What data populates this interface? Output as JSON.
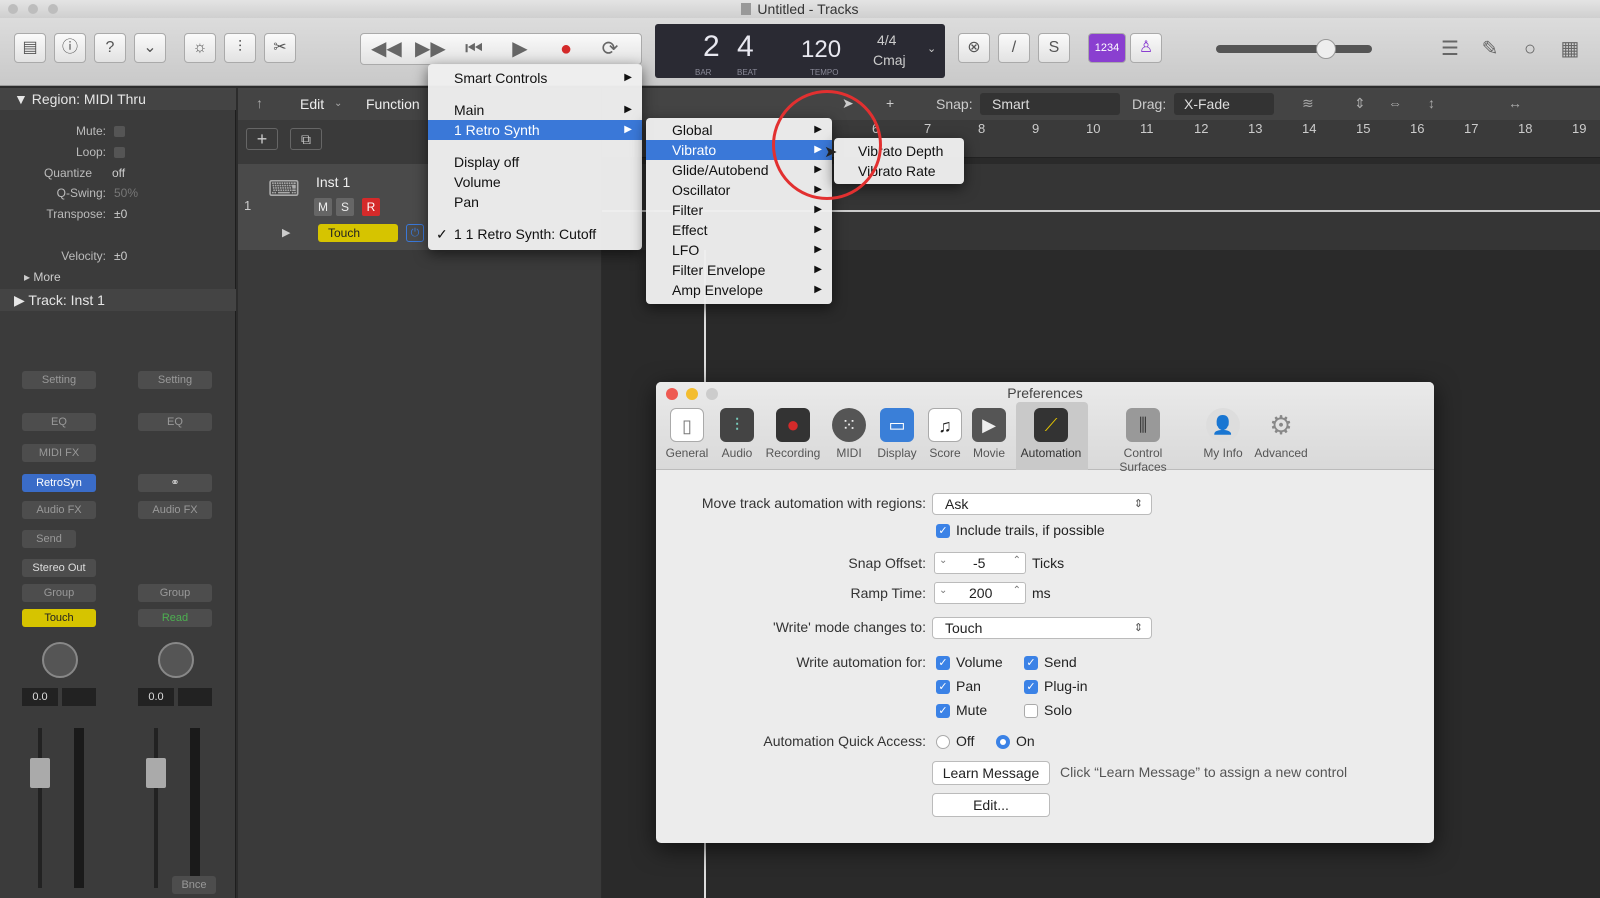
{
  "window": {
    "title": "Untitled - Tracks"
  },
  "lcd": {
    "bar": "2",
    "beat": "4",
    "bar_label": "BAR",
    "beat_label": "BEAT",
    "tempo": "120",
    "tempo_label": "TEMPO",
    "signature": "4/4",
    "key": "Cmaj"
  },
  "toolbar": {
    "count_in": "1234"
  },
  "inspector": {
    "region_title": "Region: MIDI Thru",
    "mute_label": "Mute:",
    "loop_label": "Loop:",
    "quantize_label": "Quantize",
    "quantize_value": "off",
    "qswing_label": "Q-Swing:",
    "qswing_value": "50%",
    "transpose_label": "Transpose:",
    "transpose_value": "±0",
    "velocity_label": "Velocity:",
    "velocity_value": "±0",
    "more_label": "More",
    "track_title": "Track:",
    "track_name": "Inst 1"
  },
  "channel_strips": [
    {
      "setting": "Setting",
      "eq": "EQ",
      "midifx": "MIDI FX",
      "instrument": "RetroSyn",
      "audiofx": "Audio FX",
      "send": "Send",
      "output": "Stereo Out",
      "group": "Group",
      "automation": "Touch",
      "value": "0.0"
    },
    {
      "setting": "Setting",
      "eq": "EQ",
      "audiofx": "Audio FX",
      "group": "Group",
      "automation": "Read",
      "value": "0.0",
      "bottom": "Bnce"
    }
  ],
  "tracks_area": {
    "edit_menu": "Edit",
    "function_menu": "Function",
    "track_number": "1",
    "track_name": "Inst 1",
    "m": "M",
    "s": "S",
    "r": "R",
    "automation_mode": "Touch"
  },
  "arrange_toolbar": {
    "snap_label": "Snap:",
    "snap_value": "Smart",
    "drag_label": "Drag:",
    "drag_value": "X-Fade"
  },
  "ruler": [
    "6",
    "7",
    "8",
    "9",
    "10",
    "11",
    "12",
    "13",
    "14",
    "15",
    "16",
    "17",
    "18",
    "19"
  ],
  "menu1": {
    "items": [
      {
        "label": "Smart Controls",
        "submenu": true
      },
      {
        "label": "Main",
        "submenu": true
      },
      {
        "label": "1 Retro Synth",
        "submenu": true,
        "highlighted": true
      },
      {
        "label": "Display off"
      },
      {
        "label": "Volume"
      },
      {
        "label": "Pan"
      },
      {
        "label": "1 1 Retro Synth: Cutoff",
        "checked": true
      }
    ]
  },
  "menu2": {
    "items": [
      {
        "label": "Global"
      },
      {
        "label": "Vibrato",
        "highlighted": true
      },
      {
        "label": "Glide/Autobend"
      },
      {
        "label": "Oscillator"
      },
      {
        "label": "Filter"
      },
      {
        "label": "Effect"
      },
      {
        "label": "LFO"
      },
      {
        "label": "Filter Envelope"
      },
      {
        "label": "Amp Envelope"
      }
    ]
  },
  "menu3": {
    "items": [
      {
        "label": "Vibrato Depth"
      },
      {
        "label": "Vibrato Rate"
      }
    ]
  },
  "prefs": {
    "title": "Preferences",
    "tabs": [
      "General",
      "Audio",
      "Recording",
      "MIDI",
      "Display",
      "Score",
      "Movie",
      "Automation",
      "Control Surfaces",
      "My Info",
      "Advanced"
    ],
    "active_tab": "Automation",
    "move_label": "Move track automation with regions:",
    "move_value": "Ask",
    "include_trails": "Include trails, if possible",
    "snap_offset_label": "Snap Offset:",
    "snap_offset_value": "-5",
    "snap_offset_unit": "Ticks",
    "ramp_label": "Ramp Time:",
    "ramp_value": "200",
    "ramp_unit": "ms",
    "write_mode_label": "'Write' mode changes to:",
    "write_mode_value": "Touch",
    "write_for_label": "Write automation for:",
    "write_for": [
      {
        "label": "Volume",
        "checked": true
      },
      {
        "label": "Send",
        "checked": true
      },
      {
        "label": "Pan",
        "checked": true
      },
      {
        "label": "Plug-in",
        "checked": true
      },
      {
        "label": "Mute",
        "checked": true
      },
      {
        "label": "Solo",
        "checked": false
      }
    ],
    "quick_access_label": "Automation Quick Access:",
    "off_label": "Off",
    "on_label": "On",
    "learn_button": "Learn Message",
    "learn_hint": "Click “Learn Message” to assign a new control",
    "edit_button": "Edit..."
  },
  "colors": {
    "accent": "#3a78d8",
    "record": "#d42a2a",
    "touch": "#d6c400",
    "read": "#4caf50",
    "count_in": "#8a3fd0"
  }
}
